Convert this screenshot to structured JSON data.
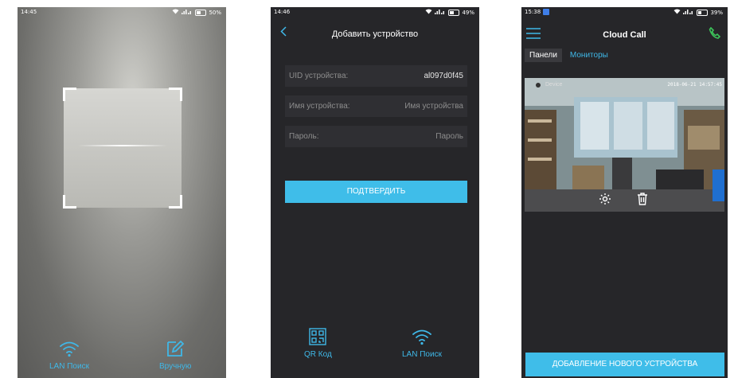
{
  "screen1": {
    "status": {
      "time": "14:45",
      "battery": "50%"
    },
    "buttons": {
      "lan_search": "LAN Поиск",
      "manual": "Вручную"
    }
  },
  "screen2": {
    "status": {
      "time": "14:46",
      "battery": "49%"
    },
    "title": "Добавить устройство",
    "fields": [
      {
        "label": "UID устройства:",
        "value": "al097d0f45"
      },
      {
        "label": "Имя устройства:",
        "placeholder": "Имя устройства"
      },
      {
        "label": "Пароль:",
        "placeholder": "Пароль"
      }
    ],
    "confirm_label": "ПОДТВЕРДИТЬ",
    "buttons": {
      "qr_code": "QR Код",
      "lan_search": "LAN Поиск"
    }
  },
  "screen3": {
    "status": {
      "time": "15:38",
      "battery": "39%"
    },
    "title": "Cloud Call",
    "tabs": [
      "Панели",
      "Мониторы"
    ],
    "camera": {
      "label": "Device",
      "timestamp": "2018-06-21 14:57:45"
    },
    "add_button": "ДОБАВЛЕНИЕ НОВОГО УСТРОЙСТВА"
  },
  "colors": {
    "accent": "#3fb8e8",
    "dark_bg": "#262629",
    "call_icon": "#3cc45a"
  }
}
